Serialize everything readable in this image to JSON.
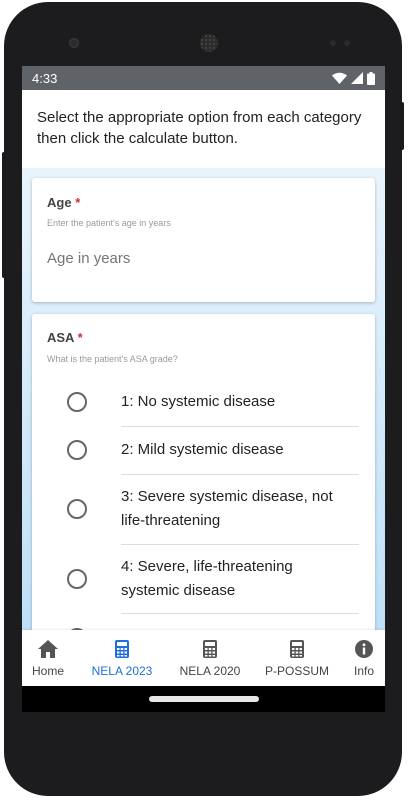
{
  "status": {
    "time": "4:33"
  },
  "intro": {
    "text": "Select the appropriate option from each category then click the calculate button."
  },
  "age_card": {
    "title": "Age",
    "required_mark": "*",
    "hint": "Enter the patient's age in years",
    "input_value": "",
    "placeholder": "Age in years"
  },
  "asa_card": {
    "title": "ASA",
    "required_mark": "*",
    "hint": "What is the patient's ASA grade?",
    "options": [
      {
        "label": "1: No systemic disease"
      },
      {
        "label": "2: Mild systemic disease"
      },
      {
        "label": "3: Severe systemic disease, not life-threatening"
      },
      {
        "label": "4: Severe, life-threatening systemic disease"
      }
    ]
  },
  "nav": {
    "items": [
      {
        "label": "Home",
        "icon": "home-icon"
      },
      {
        "label": "NELA 2023",
        "icon": "calculator-icon",
        "active": true
      },
      {
        "label": "NELA 2020",
        "icon": "calculator-icon"
      },
      {
        "label": "P-POSSUM",
        "icon": "calculator-icon"
      },
      {
        "label": "Info",
        "icon": "info-icon"
      }
    ]
  },
  "colors": {
    "accent": "#1e6fd9",
    "required": "#d32f2f",
    "statusbar": "#5f6368"
  }
}
